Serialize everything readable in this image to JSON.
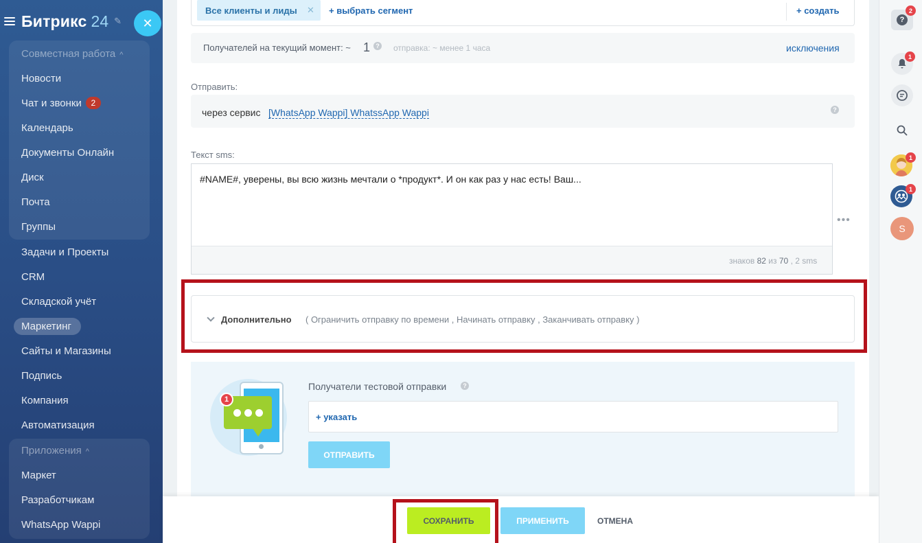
{
  "sidebar": {
    "logo": "Битрикс",
    "logo_num": "24",
    "sections": [
      {
        "label": "Совместная работа"
      },
      {
        "label": "Приложения"
      }
    ],
    "items": [
      {
        "label": "Новости"
      },
      {
        "label": "Чат и звонки",
        "badge": "2"
      },
      {
        "label": "Календарь"
      },
      {
        "label": "Документы Онлайн"
      },
      {
        "label": "Диск"
      },
      {
        "label": "Почта"
      },
      {
        "label": "Группы"
      },
      {
        "label": "Задачи и Проекты"
      },
      {
        "label": "CRM"
      },
      {
        "label": "Складской учёт"
      },
      {
        "label": "Маркетинг",
        "active": true
      },
      {
        "label": "Сайты и Магазины"
      },
      {
        "label": "Подпись"
      },
      {
        "label": "Компания"
      },
      {
        "label": "Автоматизация"
      },
      {
        "label": "Маркет"
      },
      {
        "label": "Разработчикам"
      },
      {
        "label": "WhatsApp Wappi"
      }
    ]
  },
  "segment": {
    "chip": "Все клиенты и лиды",
    "select": "+ выбрать сегмент",
    "create": "+ создать"
  },
  "recipients": {
    "label": "Получателей на текущий момент: ~",
    "count": "1",
    "eta": "отправка: ~ менее 1 часа",
    "exclusions": "исключения"
  },
  "send": {
    "label": "Отправить:",
    "via": "через сервис",
    "service": "[WhatsApp Wappi] WhatssApp Wappi"
  },
  "sms": {
    "label": "Текст sms:",
    "text": "#NAME#, уверены, вы всю жизнь мечтали о *продукт*. И он как раз у нас есть! Ваш...",
    "counter_prefix": "знаков",
    "chars": "82",
    "of": "из",
    "limit": "70",
    "sms_count": ", 2 sms"
  },
  "extra": {
    "title": "Дополнительно",
    "desc": "( Ограничить отправку по времени ,  Начинать отправку ,  Заканчивать отправку )"
  },
  "test": {
    "label": "Получатели тестовой отправки",
    "add": "+ указать",
    "send": "ОТПРАВИТЬ",
    "badge": "1"
  },
  "footer": {
    "save": "СОХРАНИТЬ",
    "apply": "ПРИМЕНИТЬ",
    "cancel": "ОТМЕНА"
  },
  "right_panel": {
    "help_badge": "2",
    "bell_badge": "1",
    "avatar_badge": "1",
    "group_badge": "1",
    "user_initial": "S"
  },
  "colors": {
    "accent": "#2067b0",
    "save_green": "#bbed21",
    "apply_blue": "#7fd6f7",
    "highlight_red": "#b5121b"
  }
}
